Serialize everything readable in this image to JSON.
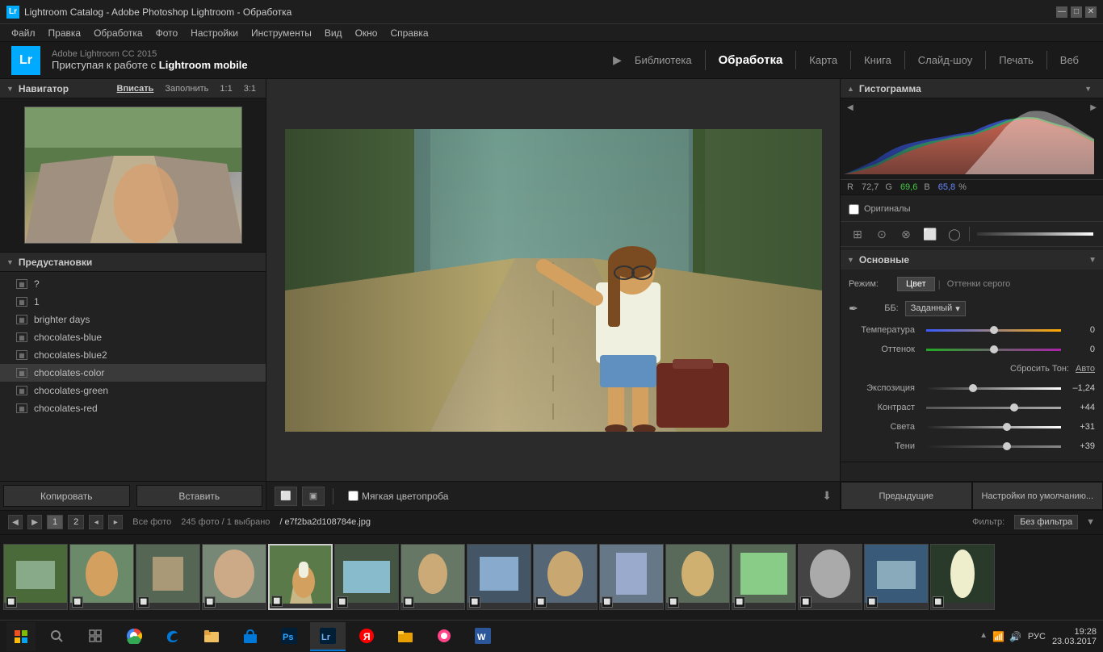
{
  "titlebar": {
    "title": "Lightroom Catalog - Adobe Photoshop Lightroom - Обработка",
    "icon": "Lr"
  },
  "menubar": {
    "items": [
      "Файл",
      "Правка",
      "Обработка",
      "Фото",
      "Настройки",
      "Инструменты",
      "Вид",
      "Окно",
      "Справка"
    ]
  },
  "topnav": {
    "logo": "Lr",
    "app_title": "Adobe Lightroom CC 2015",
    "app_subtitle_prefix": "Приступая к работе с ",
    "app_subtitle_bold": "Lightroom mobile",
    "modules": [
      "Библиотека",
      "Обработка",
      "Карта",
      "Книга",
      "Слайд-шоу",
      "Печать",
      "Веб"
    ],
    "active_module": "Обработка"
  },
  "navigator": {
    "title": "Навигатор",
    "buttons": [
      "Вписать",
      "Заполнить",
      "1:1",
      "3:1"
    ]
  },
  "presets": {
    "items": [
      {
        "name": "?",
        "selected": false
      },
      {
        "name": "1",
        "selected": false
      },
      {
        "name": "brighter days",
        "selected": false
      },
      {
        "name": "chocolates-blue",
        "selected": false
      },
      {
        "name": "chocolates-blue2",
        "selected": false
      },
      {
        "name": "chocolates-color",
        "selected": true
      },
      {
        "name": "chocolates-green",
        "selected": false
      },
      {
        "name": "chocolates-red",
        "selected": false
      }
    ]
  },
  "left_panel_buttons": {
    "copy": "Копировать",
    "paste": "Вставить"
  },
  "histogram": {
    "title": "Гистограмма",
    "r_label": "R",
    "r_value": "72,7",
    "g_label": "G",
    "g_value": "69,6",
    "b_label": "B",
    "b_value": "65,8",
    "percent": "%"
  },
  "develop": {
    "originals_label": "Оригиналы",
    "basic_section": "Основные",
    "mode_label": "Режим:",
    "mode_color": "Цвет",
    "mode_grayscale": "Оттенки серого",
    "wb_label": "ББ:",
    "wb_value": "Заданный",
    "temp_label": "Температура",
    "temp_value": "0",
    "tint_label": "Оттенок",
    "tint_value": "0",
    "reset_tone_label": "Сбросить Тон:",
    "reset_auto": "Авто",
    "exp_label": "Экспозиция",
    "exp_value": "–1,24",
    "contrast_label": "Контраст",
    "contrast_value": "+44",
    "lights_label": "Света",
    "lights_value": "+31",
    "shadows_label": "Тени",
    "shadows_value": "+39"
  },
  "photo_toolbar": {
    "soft_proof_label": "Мягкая цветопроба"
  },
  "filmstrip_toolbar": {
    "page1": "1",
    "page2": "2",
    "all_photos": "Все фото",
    "count": "245 фото / 1 выбрано",
    "path": "/ e7f2ba2d108784e.jpg",
    "filter_label": "Фильтр:",
    "filter_value": "Без фильтра"
  },
  "right_panel_bottom": {
    "prev": "Предыдущие",
    "defaults": "Настройки по умолчанию..."
  },
  "taskbar": {
    "time": "19:28",
    "date": "23.03.2017",
    "lang": "РУС"
  }
}
